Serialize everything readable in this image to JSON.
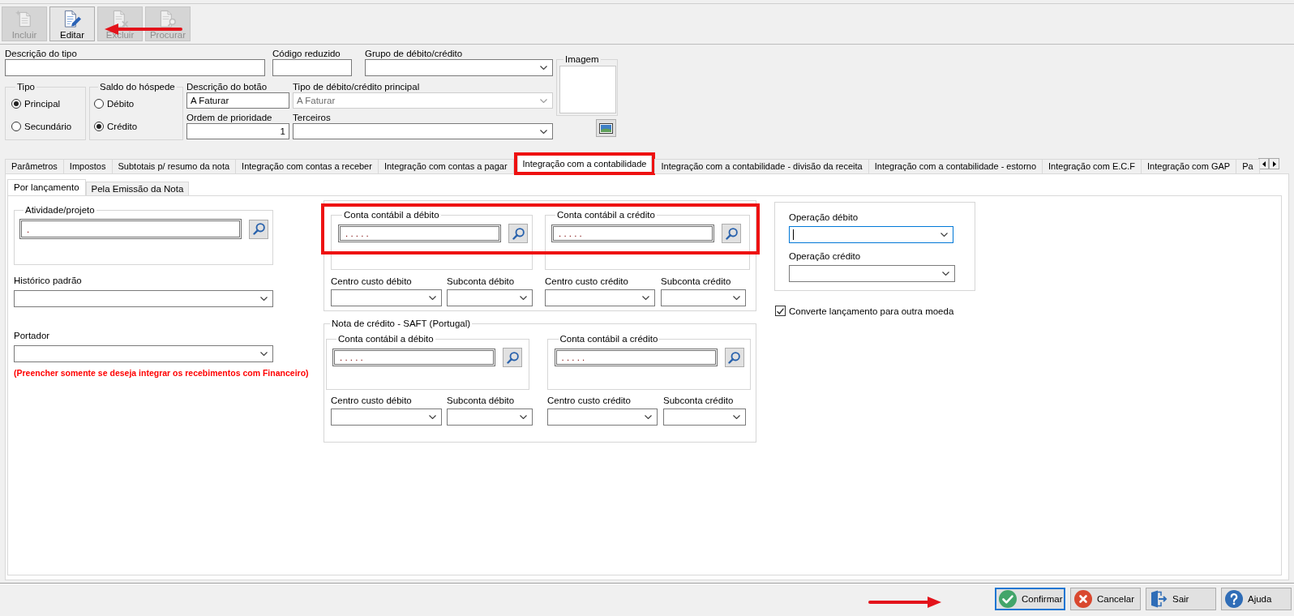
{
  "toolbar": {
    "annotation_arrow": true,
    "buttons": [
      {
        "label": "Incluir",
        "kind": "add",
        "disabled": true
      },
      {
        "label": "Editar",
        "kind": "edit",
        "disabled": false
      },
      {
        "label": "Excluir",
        "kind": "delete",
        "disabled": true
      },
      {
        "label": "Procurar",
        "kind": "find",
        "disabled": true
      }
    ]
  },
  "header": {
    "description": {
      "label": "Descrição do tipo"
    },
    "short_code": {
      "label": "Código reduzido"
    },
    "debit_credit_group": {
      "label": "Grupo de débito/crédito"
    },
    "image": {
      "label": "Imagem"
    },
    "type_group": {
      "label": "Tipo",
      "options": [
        {
          "label": "Principal",
          "selected": true
        },
        {
          "label": "Secundário",
          "selected": false
        }
      ]
    },
    "guest_balance": {
      "label": "Saldo do hóspede",
      "options": [
        {
          "label": "Débito",
          "selected": false
        },
        {
          "label": "Crédito",
          "selected": true
        }
      ]
    },
    "button_description": {
      "label": "Descrição do botão",
      "value": "A Faturar"
    },
    "main_type": {
      "label": "Tipo de débito/crédito principal",
      "value": "A Faturar",
      "disabled": true
    },
    "priority": {
      "label": "Ordem de prioridade",
      "value": "1"
    },
    "third_parties": {
      "label": "Terceiros"
    }
  },
  "tabs": [
    {
      "label": "Parâmetros",
      "selected": false,
      "highlighted": false
    },
    {
      "label": "Impostos",
      "selected": false,
      "highlighted": false
    },
    {
      "label": "Subtotais p/ resumo da nota",
      "selected": false,
      "highlighted": false
    },
    {
      "label": "Integração com contas a receber",
      "selected": false,
      "highlighted": false
    },
    {
      "label": "Integração com contas a pagar",
      "selected": false,
      "highlighted": false
    },
    {
      "label": "Integração com a contabilidade",
      "selected": true,
      "highlighted": true
    },
    {
      "label": "Integração com a contabilidade - divisão da receita",
      "selected": false,
      "highlighted": false
    },
    {
      "label": "Integração com a contabilidade - estorno",
      "selected": false,
      "highlighted": false
    },
    {
      "label": "Integração com E.C.F",
      "selected": false,
      "highlighted": false
    },
    {
      "label": "Integração com GAP",
      "selected": false,
      "highlighted": false
    },
    {
      "label": "Pa",
      "selected": false,
      "highlighted": false
    }
  ],
  "subtabs": [
    {
      "label": "Por lançamento",
      "selected": true
    },
    {
      "label": "Pela Emissão da Nota",
      "selected": false
    }
  ],
  "left": {
    "activity": {
      "label": "Atividade/projeto",
      "value": "."
    },
    "history": {
      "label": "Histórico padrão"
    },
    "bearer": {
      "label": "Portador",
      "note": "(Preencher somente se deseja integrar os recebimentos com Financeiro)"
    }
  },
  "sections": [
    {
      "highlighted": true,
      "account_fields": [
        {
          "label": "Conta contábil a débito",
          "value": ". . . . ."
        },
        {
          "label": "Conta contábil a crédito",
          "value": ". . . . ."
        }
      ],
      "combos": [
        {
          "label": "Centro custo débito"
        },
        {
          "label": "Subconta débito"
        },
        {
          "label": "Centro custo crédito"
        },
        {
          "label": "Subconta crédito"
        }
      ]
    },
    {
      "title": "Nota de crédito - SAFT (Portugal)",
      "highlighted": false,
      "account_fields": [
        {
          "label": "Conta contábil a débito",
          "value": ". . . . ."
        },
        {
          "label": "Conta contábil a crédito",
          "value": ". . . . ."
        }
      ],
      "combos": [
        {
          "label": "Centro custo débito"
        },
        {
          "label": "Subconta débito"
        },
        {
          "label": "Centro custo crédito"
        },
        {
          "label": "Subconta crédito"
        }
      ]
    }
  ],
  "operations": {
    "fields": [
      {
        "label": "Operação débito",
        "focused": true
      },
      {
        "label": "Operação crédito",
        "focused": false
      }
    ]
  },
  "convert_option": {
    "label": "Converte lançamento para outra moeda",
    "checked": true
  },
  "footer": {
    "annotation_arrow": true,
    "buttons": [
      {
        "label": "Confirmar",
        "kind": "confirm",
        "focused": true
      },
      {
        "label": "Cancelar",
        "kind": "cancel",
        "focused": false
      },
      {
        "label": "Sair",
        "kind": "exit",
        "focused": false
      },
      {
        "label": "Ajuda",
        "kind": "help",
        "focused": false
      }
    ]
  }
}
